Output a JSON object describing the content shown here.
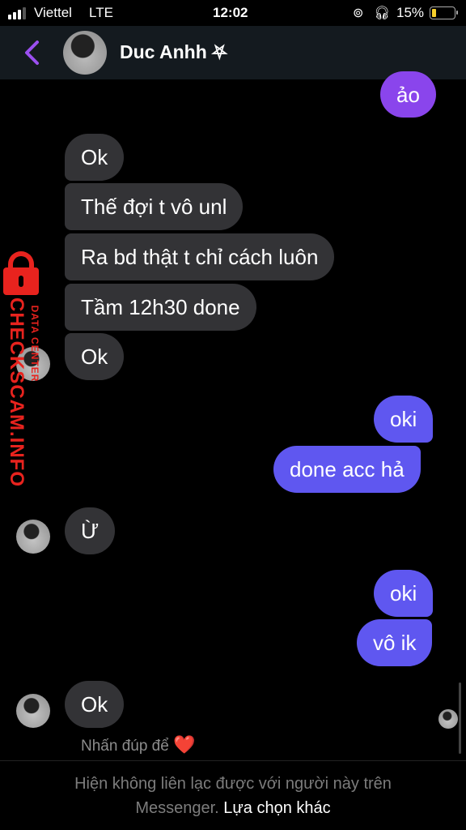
{
  "status_bar": {
    "carrier": "Viettel",
    "network": "LTE",
    "time": "12:02",
    "battery": "15%",
    "battery_level": 0.15,
    "icons": [
      "signal-bars",
      "orientation-lock",
      "headphones",
      "battery"
    ]
  },
  "header": {
    "contact_name": "Duc Anhh ⛧",
    "icons": [
      "back-chevron",
      "avatar"
    ]
  },
  "messages": [
    {
      "id": "m1",
      "dir": "out",
      "text": "ảo"
    },
    {
      "id": "m2",
      "dir": "in",
      "text": "Ok"
    },
    {
      "id": "m3",
      "dir": "in",
      "text": "Thế đợi t vô unl"
    },
    {
      "id": "m4",
      "dir": "in",
      "text": "Ra bd thật t chỉ cách luôn"
    },
    {
      "id": "m5",
      "dir": "in",
      "text": "Tầm 12h30 done"
    },
    {
      "id": "m6",
      "dir": "in",
      "text": "Ok"
    },
    {
      "id": "m7",
      "dir": "out",
      "text": "oki"
    },
    {
      "id": "m8",
      "dir": "out",
      "text": "done acc hả"
    },
    {
      "id": "m9",
      "dir": "in",
      "text": "Ừ"
    },
    {
      "id": "m10",
      "dir": "out",
      "text": "oki"
    },
    {
      "id": "m11",
      "dir": "out",
      "text": "vô ik"
    },
    {
      "id": "m12",
      "dir": "in",
      "text": "Ok"
    }
  ],
  "reaction_hint": {
    "text": "Nhấn đúp để",
    "emoji": "❤️"
  },
  "footer": {
    "text": "Hiện không liên lạc được với người này trên",
    "text2": "Messenger.",
    "link": "Lựa chọn khác"
  },
  "watermark": {
    "main": "CHECKSCAM.INFO",
    "sub": "DATA CENTER"
  },
  "colors": {
    "incoming_bubble": "#333336",
    "outgoing_bubble": "#5f57f0",
    "outgoing_bubble_top": "#8a45ec",
    "accent": "#9b4ff0",
    "watermark": "#e8231e"
  }
}
